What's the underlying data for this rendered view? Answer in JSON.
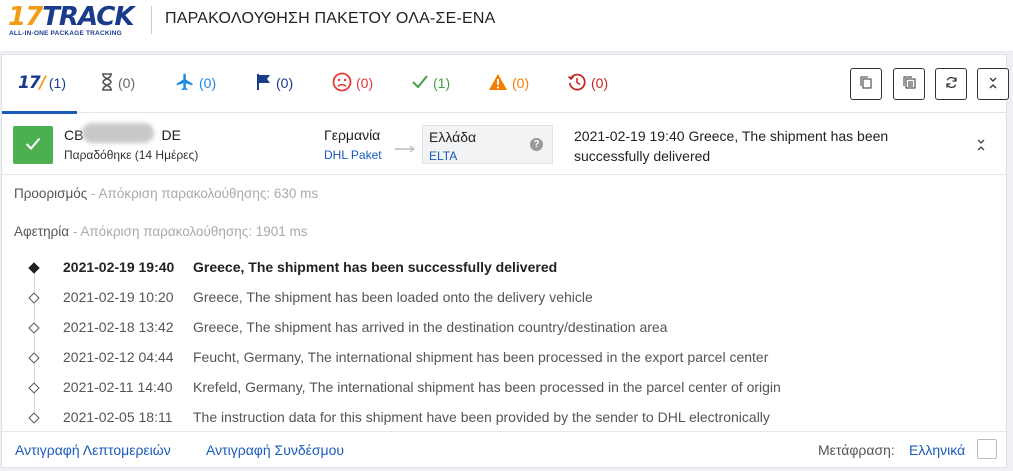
{
  "header": {
    "logo_num": "17",
    "logo_word": "TRACK",
    "logo_tagline": "ALL-IN-ONE PACKAGE TRACKING",
    "title": "ΠΑΡΑΚΟΛΟΥΘΗΣΗ ΠΑΚΕΤΟΥ ΟΛΑ-ΣΕ-ΕΝΑ"
  },
  "tabs": [
    {
      "name": "all",
      "icon": "17track-icon",
      "count": "(1)",
      "color": "#1a3b8c"
    },
    {
      "name": "not-found",
      "icon": "hourglass-icon",
      "count": "(0)",
      "color": "#666666"
    },
    {
      "name": "in-transit",
      "icon": "airplane-icon",
      "count": "(0)",
      "color": "#1e88e5"
    },
    {
      "name": "pickup",
      "icon": "flag-icon",
      "count": "(0)",
      "color": "#1a3b8c"
    },
    {
      "name": "undelivered",
      "icon": "sad-face-icon",
      "count": "(0)",
      "color": "#e53935"
    },
    {
      "name": "delivered",
      "icon": "checkmark-icon",
      "count": "(1)",
      "color": "#43a047"
    },
    {
      "name": "alert",
      "icon": "warning-icon",
      "count": "(0)",
      "color": "#f57c00"
    },
    {
      "name": "expired",
      "icon": "history-icon",
      "count": "(0)",
      "color": "#c62828"
    }
  ],
  "toolbar": [
    "copy-icon",
    "copy-all-icon",
    "refresh-icon",
    "collapse-all-icon"
  ],
  "shipment": {
    "tracking_prefix": "CB",
    "tracking_suffix": "DE",
    "status": "Παραδόθηκε (14 Ημέρες)",
    "status_color": "#4caf50",
    "origin_country": "Γερμανία",
    "origin_carrier": "DHL Paket",
    "dest_country": "Ελλάδα",
    "dest_carrier": "ELTA",
    "latest_time": "2021-02-19 19:40",
    "latest_desc": "Greece, The shipment has been successfully delivered"
  },
  "info": {
    "destination_label": "Προορισμός",
    "destination_sub": " - Απόκριση παρακολούθησης: 630 ms",
    "origin_label": "Αφετηρία",
    "origin_sub": " - Απόκριση παρακολούθησης: 1901 ms"
  },
  "events": [
    {
      "time": "2021-02-19 19:40",
      "desc": "Greece, The shipment has been successfully delivered"
    },
    {
      "time": "2021-02-19 10:20",
      "desc": "Greece, The shipment has been loaded onto the delivery vehicle"
    },
    {
      "time": "2021-02-18 13:42",
      "desc": "Greece, The shipment has arrived in the destination country/destination area"
    },
    {
      "time": "2021-02-12 04:44",
      "desc": "Feucht, Germany, The international shipment has been processed in the export parcel center"
    },
    {
      "time": "2021-02-11 14:40",
      "desc": "Krefeld, Germany, The international shipment has been processed in the parcel center of origin"
    },
    {
      "time": "2021-02-05 18:11",
      "desc": "The instruction data for this shipment have been provided by the sender to DHL electronically"
    }
  ],
  "footer": {
    "copy_details": "Αντιγραφή Λεπτομερειών",
    "copy_link": "Αντιγραφή Συνδέσμου",
    "translate_label": "Μετάφραση:",
    "translate_lang": "Ελληνικά"
  }
}
